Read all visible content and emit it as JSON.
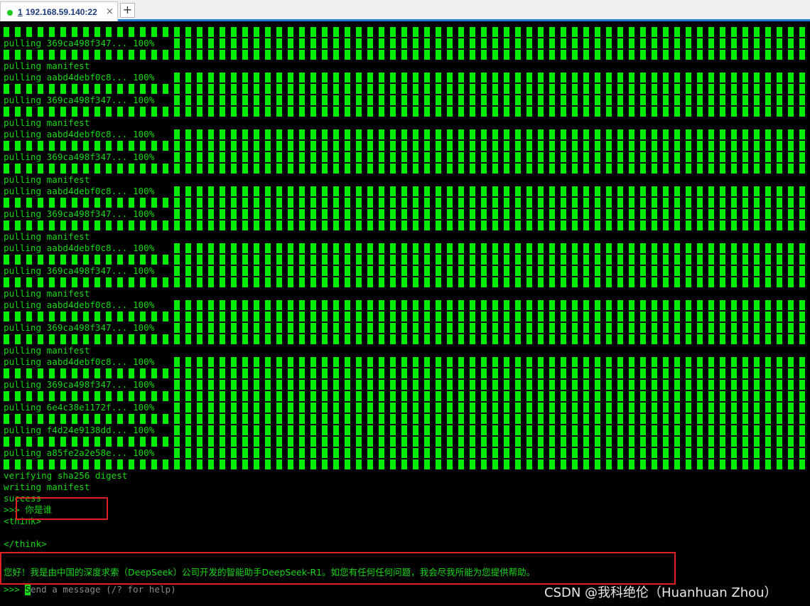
{
  "tab": {
    "index": "1",
    "host": "192.168.59.140:22",
    "close": "×",
    "new_tab": "+"
  },
  "colors": {
    "terminal_bg": "#000000",
    "terminal_fg": "#17d817",
    "progress": "#00ee00",
    "highlight": "#e02020",
    "tab_accent": "#1e7fd6",
    "status_dot": "#1ec81e"
  },
  "pull_lines": [
    "pulling 369ca498f347... 100%",
    "pulling manifest",
    "pulling aabd4debf0c8... 100%",
    "pulling 369ca498f347... 100%",
    "pulling manifest",
    "pulling aabd4debf0c8... 100%",
    "pulling 369ca498f347... 100%",
    "pulling manifest",
    "pulling aabd4debf0c8... 100%",
    "pulling 369ca498f347... 100%",
    "pulling manifest",
    "pulling aabd4debf0c8... 100%",
    "pulling 369ca498f347... 100%",
    "pulling manifest",
    "pulling aabd4debf0c8... 100%",
    "pulling 369ca498f347... 100%",
    "pulling manifest",
    "pulling aabd4debf0c8... 100%",
    "pulling 369ca498f347... 100%",
    "pulling 6e4c38e1172f... 100%",
    "pulling f4d24e9138dd... 100%",
    "pulling a85fe2a2e58e... 100%"
  ],
  "progress_percent": 100,
  "verifying": "verifying sha256 digest",
  "writing": "writing manifest",
  "success": "success",
  "prompt_symbol": ">>>",
  "user_query": "你是谁",
  "think_open": "<think>",
  "think_close": "</think>",
  "answer": "您好！我是由中国的深度求索（DeepSeek）公司开发的智能助手DeepSeek-R1。如您有任何任何问题，我会尽我所能为您提供帮助。",
  "input_cursor_char": "S",
  "input_placeholder_rest": "end a message (/? for help)",
  "watermark": "CSDN @我科绝伦（Huanhuan Zhou）"
}
